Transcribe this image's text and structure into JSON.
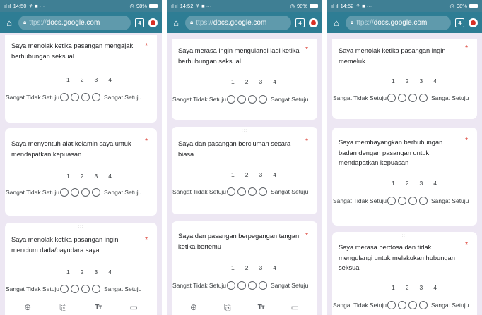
{
  "phones": [
    {
      "status_time": "14:50",
      "battery": "98%",
      "url": {
        "prefix": "ttps://",
        "domain": "docs.google.com"
      },
      "tab_count": "4",
      "cards": [
        {
          "question": "Saya menolak ketika pasangan mengajak berhubungan seksual"
        },
        {
          "question": "Saya menyentuh alat kelamin saya untuk mendapatkan kepuasan"
        },
        {
          "question": "Saya menolak ketika pasangan ingin mencium dada/payudara saya"
        }
      ]
    },
    {
      "status_time": "14:52",
      "battery": "98%",
      "url": {
        "prefix": "ttps://",
        "domain": "docs.google.com"
      },
      "tab_count": "4",
      "cards": [
        {
          "question": "Saya merasa ingin mengulangi lagi ketika berhubungan seksual"
        },
        {
          "question": "Saya dan pasangan berciuman secara biasa"
        },
        {
          "question": "Saya dan pasangan berpegangan tangan ketika bertemu"
        }
      ]
    },
    {
      "status_time": "14:52",
      "battery": "98%",
      "url": {
        "prefix": "ttps://",
        "domain": "docs.google.com"
      },
      "tab_count": "4",
      "cards": [
        {
          "question": "Saya menolak ketika pasangan ingin memeluk"
        },
        {
          "question": "Saya membayangkan berhubungan badan dengan pasangan untuk mendapatkan kepuasan"
        },
        {
          "question": "Saya merasa berdosa dan tidak mengulangi untuk melakukan hubungan seksual"
        }
      ]
    }
  ],
  "scale": {
    "numbers": [
      "1",
      "2",
      "3",
      "4"
    ],
    "left_label": "Sangat Tidak Setuju",
    "right_label": "Sangat Setuju"
  },
  "required_marker": "*",
  "drag_handle": ":::",
  "bottom_toolbar": {
    "icons": [
      "add-question-icon",
      "import-questions-icon",
      "add-title-icon",
      "add-image-icon"
    ],
    "title_glyph": "Tт"
  }
}
